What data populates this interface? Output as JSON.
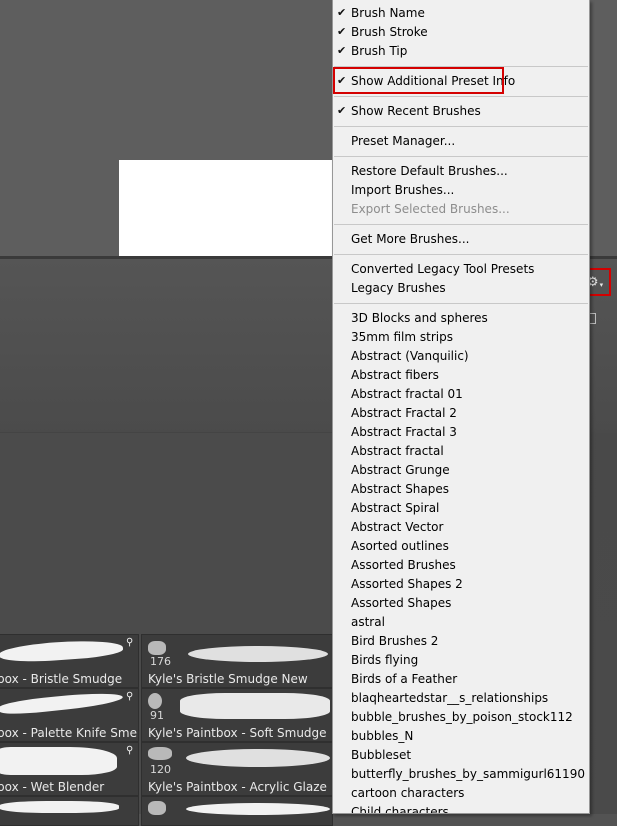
{
  "menu": {
    "view_options": [
      {
        "label": "Brush Name",
        "checked": true
      },
      {
        "label": "Brush Stroke",
        "checked": true
      },
      {
        "label": "Brush Tip",
        "checked": true
      }
    ],
    "show_additional": {
      "label": "Show Additional Preset Info",
      "checked": true
    },
    "show_recent": {
      "label": "Show Recent Brushes",
      "checked": true
    },
    "preset_manager": "Preset Manager...",
    "restore_default": "Restore Default Brushes...",
    "import_brushes": "Import Brushes...",
    "export_selected": "Export Selected Brushes...",
    "get_more": "Get More Brushes...",
    "converted_legacy": "Converted Legacy Tool Presets",
    "legacy_brushes": "Legacy Brushes",
    "libraries": [
      "3D Blocks and spheres",
      "35mm film strips",
      "Abstract (Vanquilic)",
      "Abstract fibers",
      "Abstract fractal 01",
      "Abstract Fractal 2",
      "Abstract Fractal 3",
      "Abstract fractal",
      "Abstract Grunge",
      "Abstract Shapes",
      "Abstract Spiral",
      "Abstract Vector",
      "Asorted outlines",
      "Assorted Brushes",
      "Assorted Shapes 2",
      "Assorted Shapes",
      "astral",
      "Bird Brushes 2",
      "Birds flying",
      "Birds of a Feather",
      "blaqheartedstar__s_relationships",
      "bubble_brushes_by_poison_stock112",
      "bubbles_N",
      "Bubbleset",
      "butterfly_brushes_by_sammigurl61190",
      "cartoon characters",
      "Child characters"
    ]
  },
  "brushes": {
    "row1": {
      "left_name": "box - Bristle Smudge",
      "right_count": "176",
      "right_name": "Kyle's Bristle Smudge New"
    },
    "row2": {
      "left_name": "box - Palette Knife Sme...",
      "right_count": "91",
      "right_name": "Kyle's Paintbox - Soft Smudge"
    },
    "row3": {
      "left_name": "box - Wet Blender",
      "right_count": "120",
      "right_name": "Kyle's Paintbox - Acrylic Glaze"
    }
  },
  "icons": {
    "check": "✔",
    "gear": "⚙",
    "gear_caret": "▾",
    "pin": "⚲"
  },
  "colors": {
    "highlight": "#d40000",
    "menu_bg": "#f0f0f0",
    "panel_bg": "#4a4a4a"
  }
}
